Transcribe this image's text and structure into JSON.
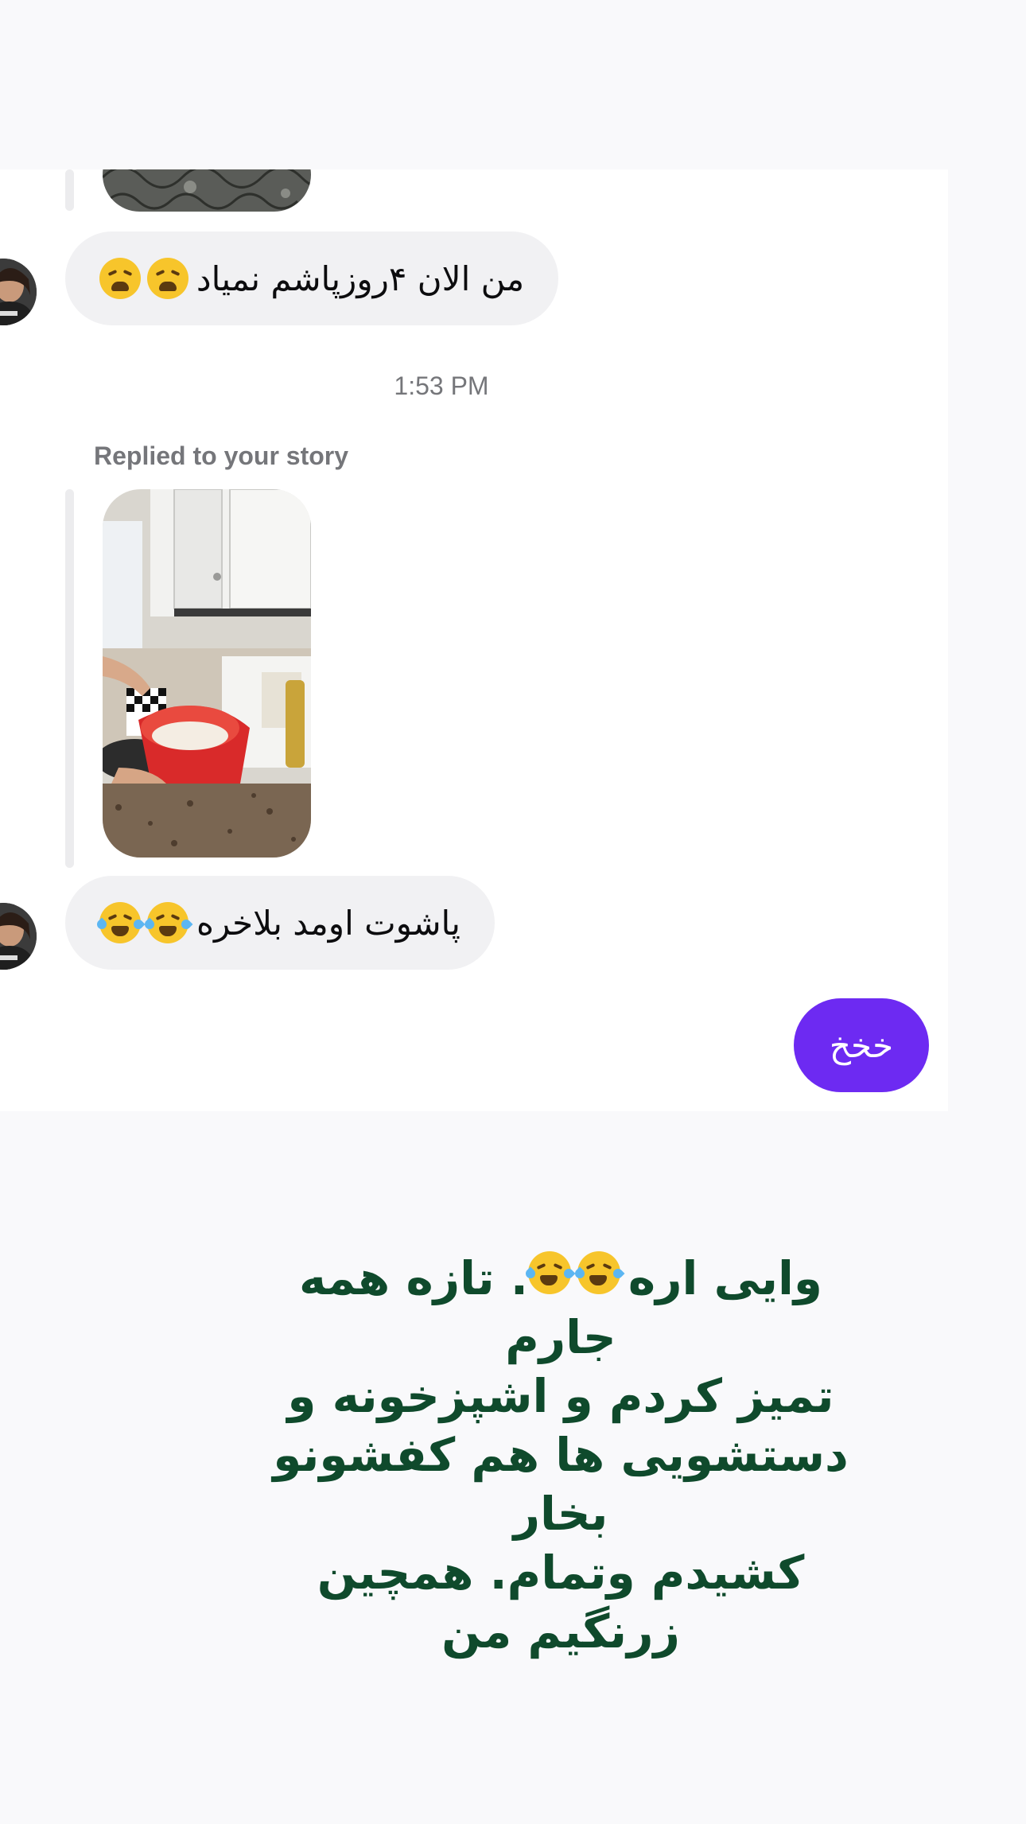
{
  "chat": {
    "messages": [
      {
        "type": "text",
        "text": "من الان ۴روزپاشم نمیاد",
        "emoji": [
          "weary-face",
          "weary-face"
        ]
      },
      {
        "type": "timestamp",
        "text": "1:53 PM"
      },
      {
        "type": "story_reply_label",
        "text": "Replied to your story"
      },
      {
        "type": "text",
        "text": "پاشوت اومد بلاخره",
        "emoji": [
          "rolling-on-floor-laughing",
          "rolling-on-floor-laughing"
        ]
      },
      {
        "type": "outgoing",
        "text": "خخخ"
      }
    ]
  },
  "caption": {
    "line1": "وایی اره",
    "line1_tail": ". تازه همه جارم",
    "line2": "تمیز کردم و اشپزخونه و",
    "line3": "دستشویی ها هم کفشونو بخار",
    "line4": "کشیدم وتمام. همچین زرنگیم من"
  },
  "colors": {
    "outgoing_bubble": "#6d2af2",
    "incoming_bubble": "#f1f1f3",
    "caption_text": "#0f4a2c",
    "meta_text": "#75767a"
  }
}
